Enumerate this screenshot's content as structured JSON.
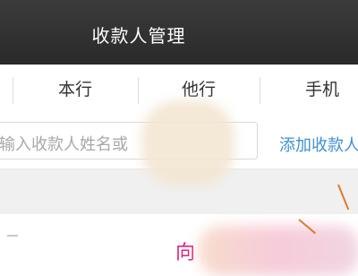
{
  "header": {
    "title": "收款人管理"
  },
  "tabs": [
    {
      "label": "本行"
    },
    {
      "label": "他行"
    },
    {
      "label": "手机"
    }
  ],
  "search": {
    "placeholder": "输入收款人姓名或"
  },
  "actions": {
    "add_label": "添加收款人"
  },
  "content": {
    "text": "向"
  },
  "colors": {
    "header_bg": "#2f2f2f",
    "link": "#3f8fd6",
    "accent_pink": "#e0207a",
    "annotation": "#e07a2c"
  }
}
